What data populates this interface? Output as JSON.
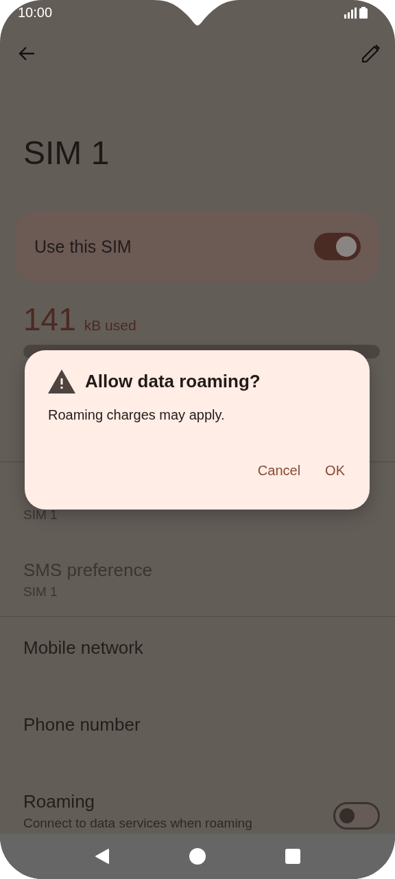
{
  "status_bar": {
    "time": "10:00"
  },
  "title": "SIM 1",
  "use_sim": {
    "label": "Use this SIM",
    "on": true
  },
  "data_usage": {
    "amount": "141",
    "unit": "kB used"
  },
  "sim_preferences": [
    {
      "subtitle": "SIM 1",
      "disabled": true
    },
    {
      "title": "SMS preference",
      "subtitle": "SIM 1",
      "disabled": true
    }
  ],
  "settings": [
    {
      "kind": "text",
      "title": "Mobile network"
    },
    {
      "kind": "text",
      "title": "Phone number"
    },
    {
      "kind": "switch",
      "title": "Roaming",
      "subtitle": "Connect to data services when roaming",
      "on": false
    }
  ],
  "dialog": {
    "title": "Allow data roaming?",
    "message": "Roaming charges may apply.",
    "buttons": [
      "Cancel",
      "OK"
    ]
  }
}
